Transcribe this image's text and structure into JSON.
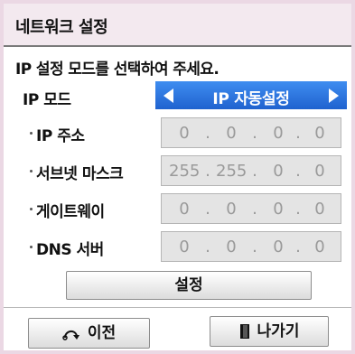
{
  "dialog": {
    "title": "네트워크 설정",
    "instruction": "IP 설정 모드를 선택하여 주세요."
  },
  "ip_mode": {
    "label": "IP 모드",
    "value": "IP 자동설정",
    "left_icon": "triangle-left-icon",
    "right_icon": "triangle-right-icon"
  },
  "fields": {
    "ip_address": {
      "label": "IP 주소",
      "octets": [
        "0",
        "0",
        "0",
        "0"
      ]
    },
    "subnet_mask": {
      "label": "서브넷 마스크",
      "octets": [
        "255",
        "255",
        "0",
        "0"
      ]
    },
    "gateway": {
      "label": "게이트웨이",
      "octets": [
        "0",
        "0",
        "0",
        "0"
      ]
    },
    "dns": {
      "label": "DNS 서버",
      "octets": [
        "0",
        "0",
        "0",
        "0"
      ]
    },
    "separator": "."
  },
  "buttons": {
    "set": "설정",
    "back": "이전",
    "back_icon": "return-arrow-icon",
    "exit": "나가기",
    "exit_icon": "door-icon"
  },
  "colors": {
    "selector_blue": "#2a74e0",
    "field_bg": "#e4e4e4",
    "title_bg": "#f3e9ef",
    "page_bg": "#ebd8e4"
  }
}
